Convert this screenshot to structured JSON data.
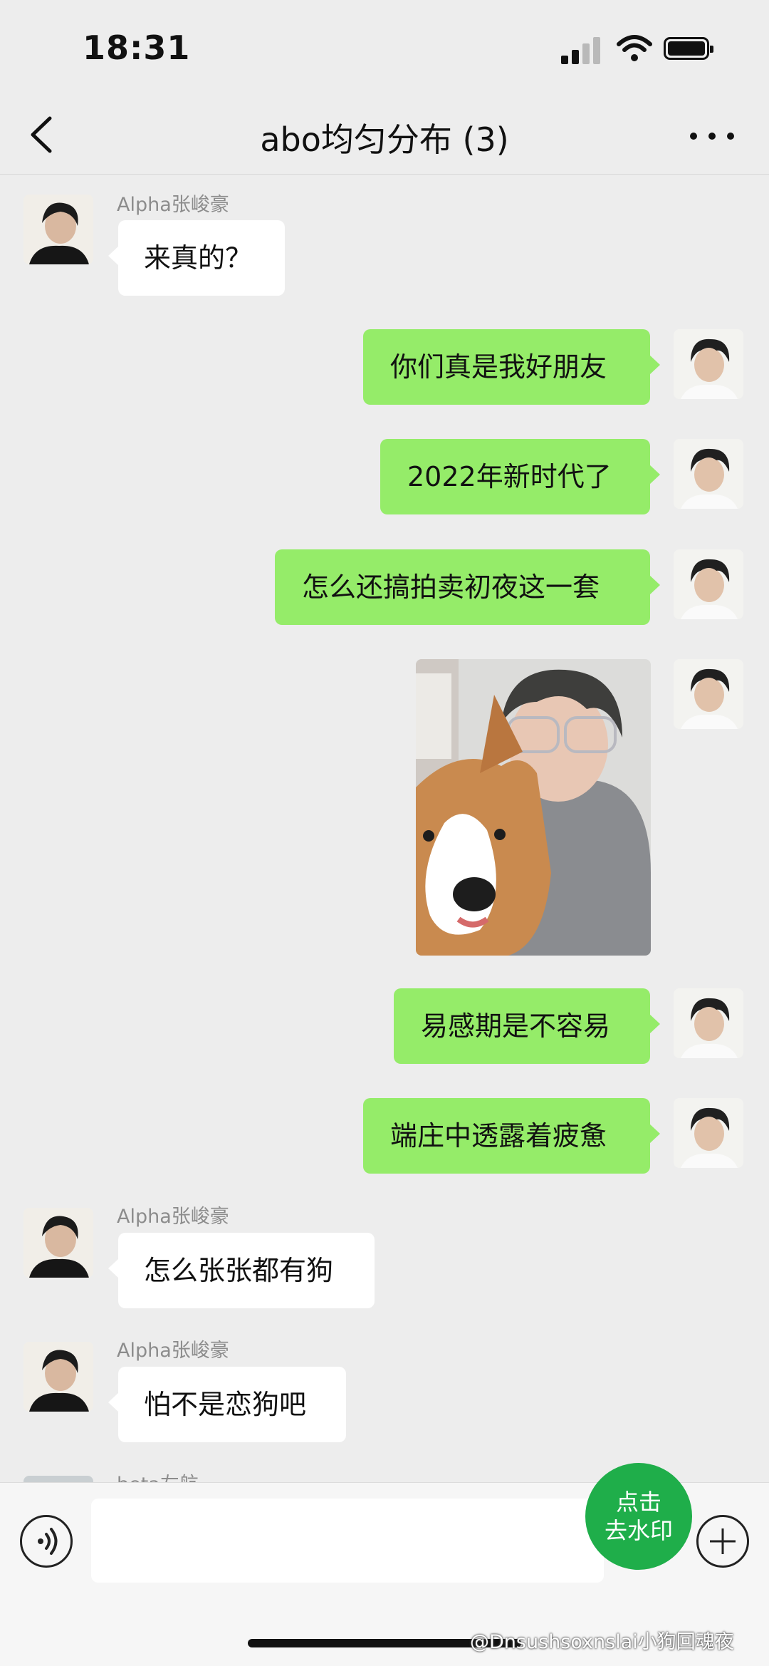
{
  "status_bar": {
    "time": "18:31"
  },
  "nav": {
    "title": "abo均匀分布 (3)",
    "back_icon": "chevron-left-icon",
    "more_icon": "more-dots-icon"
  },
  "messages": [
    {
      "side": "in",
      "sender": "Alpha张峻豪",
      "text": "来真的？"
    },
    {
      "side": "out",
      "text": "你们真是我好朋友"
    },
    {
      "side": "out",
      "text": "2022年新时代了"
    },
    {
      "side": "out",
      "text": "怎么还搞拍卖初夜这一套"
    },
    {
      "side": "out",
      "type": "image",
      "image": "photo-person-with-corgi"
    },
    {
      "side": "out",
      "text": "易感期是不容易"
    },
    {
      "side": "out",
      "text": "端庄中透露着疲惫"
    },
    {
      "side": "in",
      "sender": "Alpha张峻豪",
      "text": "怎么张张都有狗"
    },
    {
      "side": "in",
      "sender": "Alpha张峻豪",
      "text": "怕不是恋狗吧"
    },
    {
      "side": "in",
      "sender": "beta左航",
      "text": ""
    }
  ],
  "input_bar": {
    "voice_icon": "voice-icon",
    "plus_icon": "plus-icon",
    "text_value": ""
  },
  "watermark_button": {
    "line1": "点击",
    "line2": "去水印"
  },
  "credit": "@Dnsushsoxnslai小狗回魂夜",
  "colors": {
    "background": "#ededed",
    "outgoing_bubble": "#95ec69",
    "incoming_bubble": "#ffffff",
    "watermark_button": "#1fae4a"
  }
}
